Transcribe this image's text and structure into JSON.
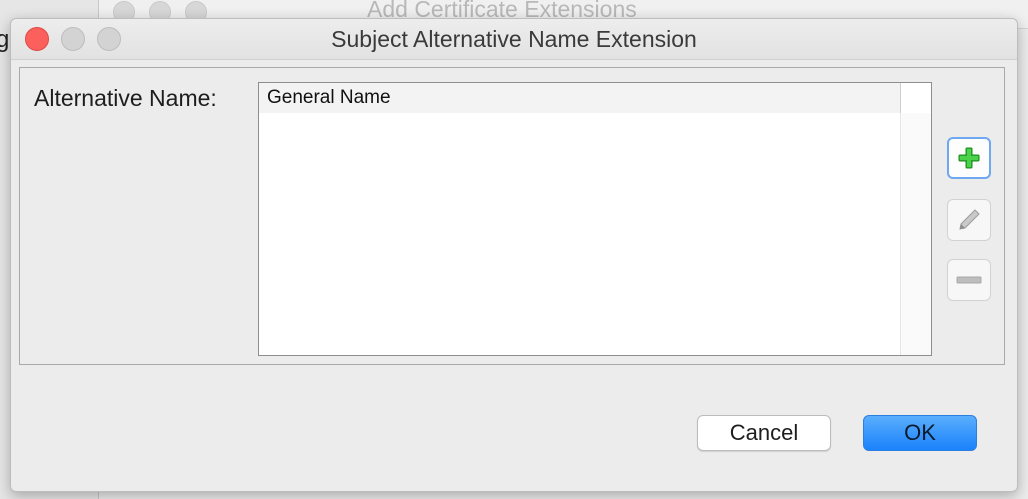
{
  "background_window": {
    "title": "Add Certificate Extensions",
    "left_fragment": "g"
  },
  "dialog": {
    "title": "Subject Alternative Name Extension",
    "alternative_name_label": "Alternative Name:",
    "table": {
      "columns": [
        "General Name"
      ],
      "rows": []
    },
    "side_buttons": {
      "add_icon": "plus-icon",
      "edit_icon": "pencil-icon",
      "remove_icon": "minus-icon"
    },
    "buttons": {
      "cancel": "Cancel",
      "ok": "OK"
    }
  },
  "colors": {
    "close_light": "#fc605c",
    "ok_button": "#1a82fb",
    "add_icon": "#2fb62f",
    "focus_ring": "#6ea8f0"
  }
}
